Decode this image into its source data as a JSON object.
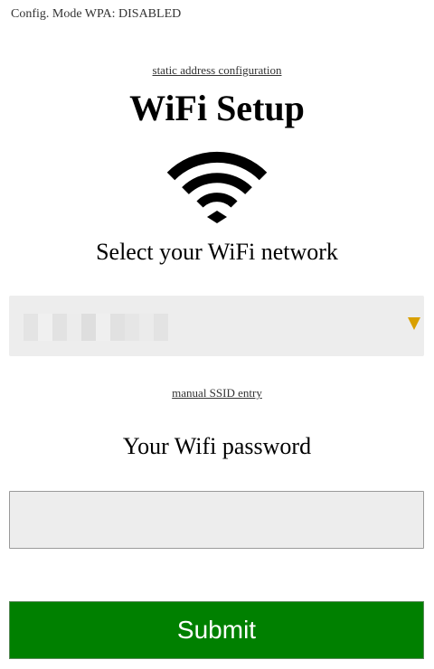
{
  "header": {
    "config_mode": "Config. Mode WPA: DISABLED",
    "static_link": "static address configuration",
    "title": "WiFi Setup"
  },
  "network": {
    "label": "Select your WiFi network",
    "selected_value": "",
    "arrow_color": "#d9a000",
    "manual_link": "manual SSID entry"
  },
  "password": {
    "label": "Your Wifi password",
    "value": "",
    "placeholder": ""
  },
  "submit": {
    "label": "Submit",
    "color": "#008000"
  },
  "icons": {
    "wifi": "wifi-icon"
  }
}
